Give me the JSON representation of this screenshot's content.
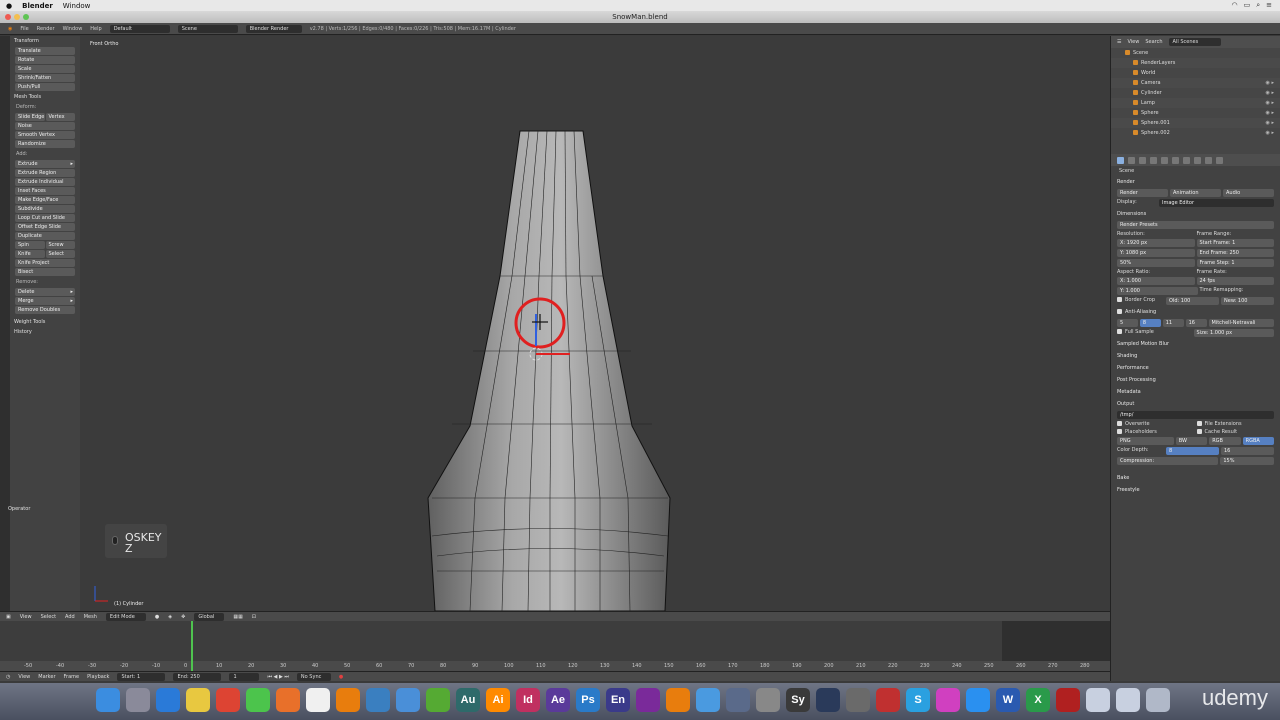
{
  "menubar": {
    "app": "Blender",
    "items": [
      "Window"
    ]
  },
  "window": {
    "title": "SnowMan.blend"
  },
  "infobar": {
    "menus": [
      "File",
      "Render",
      "Window",
      "Help"
    ],
    "layout": "Default",
    "scene": "Scene",
    "engine": "Blender Render",
    "stats": "v2.78 | Verts:1/256 | Edges:0/480 | Faces:0/226 | Tris:508 | Mem:16.17M | Cylinder"
  },
  "toolshelf": {
    "transform_header": "Transform",
    "transform": [
      "Translate",
      "Rotate",
      "Scale",
      "Shrink/Fatten",
      "Push/Pull"
    ],
    "mesh_tools_header": "Mesh Tools",
    "deform_label": "Deform:",
    "slide_edge": "Slide Edge",
    "vertex": "Vertex",
    "deform": [
      "Noise",
      "Smooth Vertex",
      "Randomize"
    ],
    "add_label": "Add:",
    "extrude": "Extrude",
    "add": [
      "Extrude Region",
      "Extrude Individual",
      "Inset Faces",
      "Make Edge/Face",
      "Subdivide",
      "Loop Cut and Slide",
      "Offset Edge Slide",
      "Duplicate"
    ],
    "spin": "Spin",
    "screw": "Screw",
    "knife": "Knife",
    "select": "Select",
    "add2": [
      "Knife Project",
      "Bisect"
    ],
    "remove_label": "Remove:",
    "delete": "Delete",
    "merge": "Merge",
    "remove_doubles": "Remove Doubles",
    "weight_tools": "Weight Tools",
    "history": "History",
    "operator": "Operator"
  },
  "viewport": {
    "title": "Front Ortho",
    "object": "(1) Cylinder",
    "oskey_line1": "OSKEY",
    "oskey_line2": "Z"
  },
  "viewheader": {
    "items": [
      "View",
      "Select",
      "Add",
      "Mesh"
    ],
    "mode": "Edit Mode",
    "orientation": "Global"
  },
  "timeline": {
    "ticks": [
      "-50",
      "-40",
      "-30",
      "-20",
      "-10",
      "0",
      "10",
      "20",
      "30",
      "40",
      "50",
      "60",
      "70",
      "80",
      "90",
      "100",
      "110",
      "120",
      "130",
      "140",
      "150",
      "160",
      "170",
      "180",
      "190",
      "200",
      "210",
      "220",
      "230",
      "240",
      "250",
      "260",
      "270",
      "280"
    ],
    "menus": [
      "View",
      "Marker",
      "Frame",
      "Playback"
    ],
    "start": "Start:",
    "start_val": "1",
    "end": "End:",
    "end_val": "250",
    "current": "1",
    "sync": "No Sync"
  },
  "outliner": {
    "menus": [
      "View",
      "Search"
    ],
    "filter": "All Scenes",
    "rows": [
      "Scene",
      "RenderLayers",
      "World",
      "Camera",
      "Cylinder",
      "Lamp",
      "Sphere",
      "Sphere.001",
      "Sphere.002"
    ]
  },
  "properties": {
    "breadcrumb": "Scene",
    "render_header": "Render",
    "render_btn": "Render",
    "animation_btn": "Animation",
    "audio_btn": "Audio",
    "display_label": "Display:",
    "display_val": "Image Editor",
    "dimensions_header": "Dimensions",
    "render_presets": "Render Presets",
    "resolution_label": "Resolution:",
    "res_x": "X: 1920 px",
    "res_y": "Y: 1080 px",
    "res_pct": "50%",
    "frame_range_label": "Frame Range:",
    "start_frame": "Start Frame: 1",
    "end_frame": "End Frame: 250",
    "frame_step": "Frame Step: 1",
    "aspect_label": "Aspect Ratio:",
    "asp_x": "X: 1.000",
    "asp_y": "Y: 1.000",
    "frame_rate_label": "Frame Rate:",
    "fps": "24 fps",
    "time_remap": "Time Remapping:",
    "old": "Old: 100",
    "new": "New: 100",
    "border": "Border",
    "crop": "Crop",
    "aa_header": "Anti-Aliasing",
    "aa_samples": [
      "5",
      "8",
      "11",
      "16"
    ],
    "aa_filter": "Mitchell-Netravali",
    "full_sample": "Full Sample",
    "size": "Size: 1.000 px",
    "closed_sections": [
      "Sampled Motion Blur",
      "Shading",
      "Performance",
      "Post Processing",
      "Metadata"
    ],
    "output_header": "Output",
    "output_path": "/tmp/",
    "overwrite": "Overwrite",
    "file_ext": "File Extensions",
    "placeholders": "Placeholders",
    "cache_result": "Cache Result",
    "format": "PNG",
    "bw": "BW",
    "rgb": "RGB",
    "rgba": "RGBA",
    "color_depth": "Color Depth:",
    "depth_8": "8",
    "depth_16": "16",
    "compression": "Compression:",
    "compression_val": "15%",
    "bake": "Bake",
    "freestyle": "Freestyle"
  },
  "dock": {
    "icons": [
      "finder-icon",
      "launchpad-icon",
      "safari-icon",
      "notes-icon",
      "chrome-icon",
      "messages-icon",
      "firefox-icon",
      "textedit-icon",
      "blender-icon",
      "files-icon",
      "keynote-icon",
      "frog-icon",
      "audition-icon",
      "illustrator-icon",
      "indesign-icon",
      "aftereffects-icon",
      "photoshop-icon",
      "encore-icon",
      "premiere-icon",
      "blender2-icon",
      "xcode-icon",
      "pen-icon",
      "settings-icon",
      "sy-icon",
      "clapper-icon",
      "calculator-icon",
      "lifesaver-icon",
      "skype-icon",
      "itunes-icon",
      "appstore-icon",
      "word-icon",
      "excel-icon",
      "acrobat-icon",
      "folder-icon",
      "folder2-icon",
      "trash-icon"
    ],
    "watermark": "udemy"
  }
}
